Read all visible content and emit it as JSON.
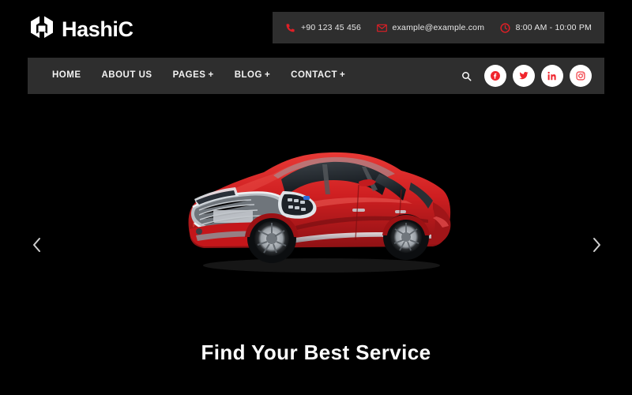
{
  "site": {
    "background_color": "#000000",
    "bar_color": "#2e2e2e",
    "accent_color": "#e01f26"
  },
  "header": {
    "logo": {
      "mark_icon": "hashicorp-hexagon-h-icon",
      "text": "HashiC"
    },
    "contact_bar": {
      "phone": {
        "icon": "phone-icon",
        "text": "+90 123 45 456"
      },
      "email": {
        "icon": "envelope-icon",
        "text": "example@example.com"
      },
      "hours": {
        "icon": "clock-icon",
        "text": "8:00 AM - 10:00 PM"
      }
    },
    "nav": {
      "items": [
        {
          "label": "HOME",
          "has_dropdown": false,
          "suffix": ""
        },
        {
          "label": "ABOUT US",
          "has_dropdown": false,
          "suffix": ""
        },
        {
          "label": "PAGES",
          "has_dropdown": true,
          "suffix": "+"
        },
        {
          "label": "BLOG",
          "has_dropdown": true,
          "suffix": "+"
        },
        {
          "label": "CONTACT",
          "has_dropdown": true,
          "suffix": "+"
        }
      ],
      "search_icon": "search-icon",
      "social": [
        {
          "name": "facebook",
          "icon": "facebook-icon"
        },
        {
          "name": "twitter",
          "icon": "twitter-icon"
        },
        {
          "name": "linkedin",
          "icon": "linkedin-icon"
        },
        {
          "name": "instagram",
          "icon": "instagram-icon"
        }
      ]
    }
  },
  "hero": {
    "title": "Find Your Best Service",
    "image_alt": "red luxury sedan car",
    "prev_icon": "chevron-left-icon",
    "next_icon": "chevron-right-icon"
  }
}
